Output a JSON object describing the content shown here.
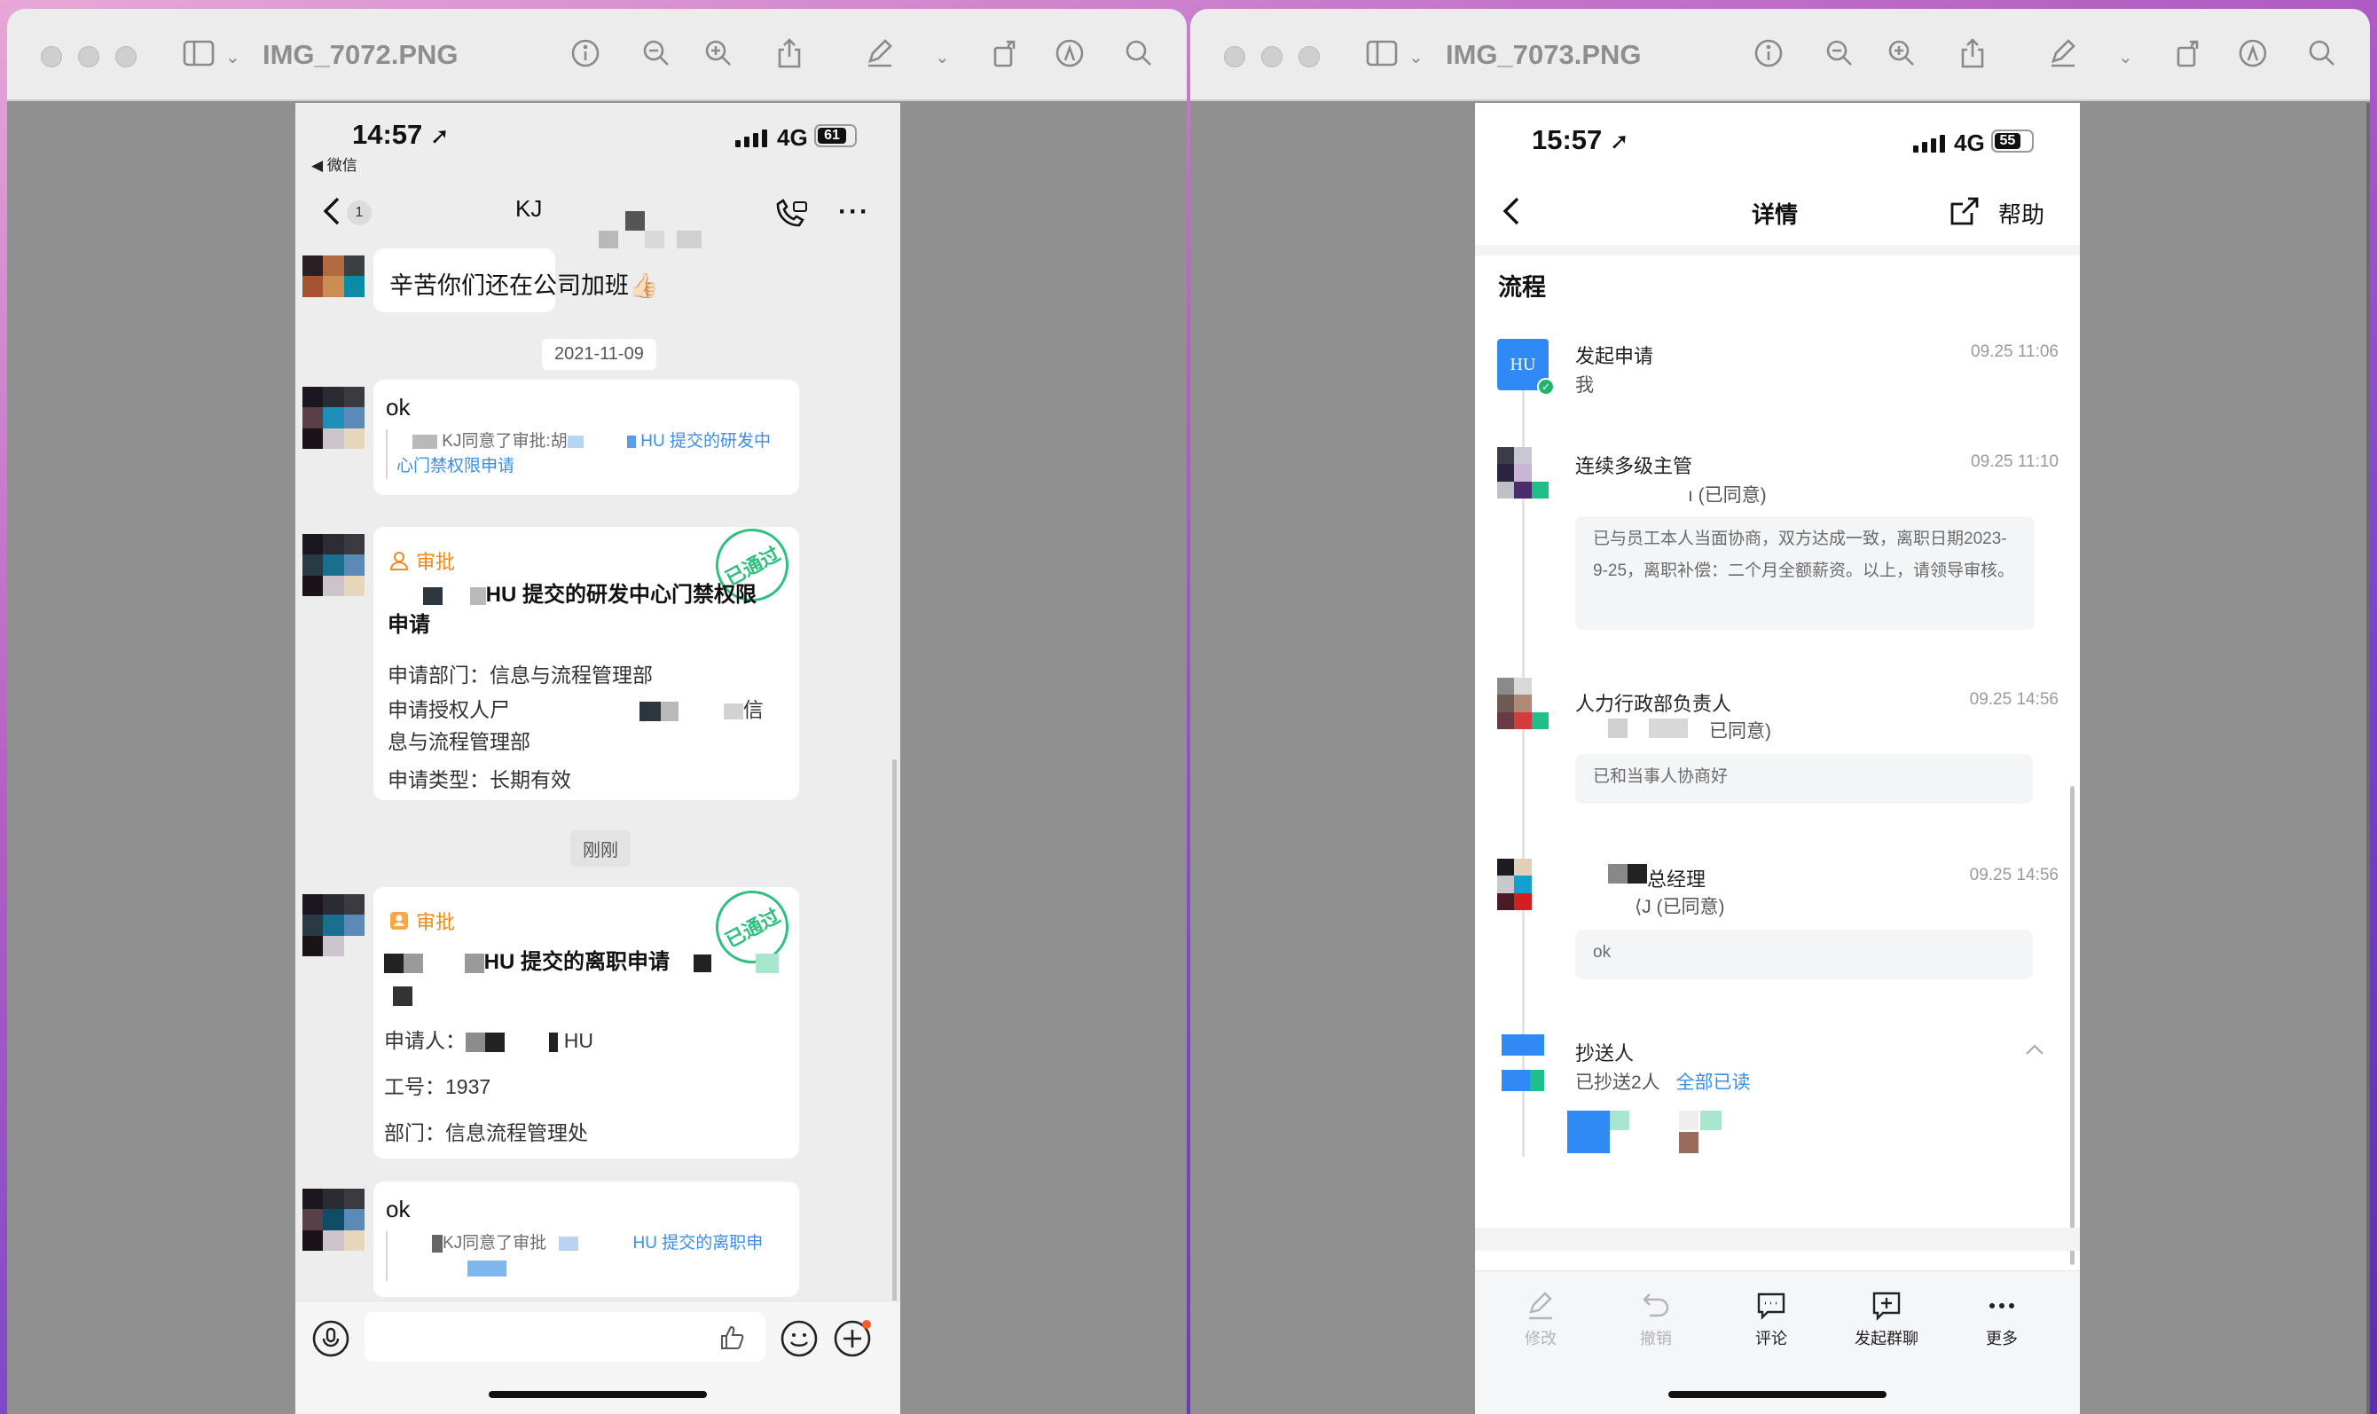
{
  "left_window": {
    "title": "IMG_7072.PNG",
    "status": {
      "time": "14:57",
      "network": "4G",
      "battery": "61",
      "back_app": "◀ 微信"
    },
    "chat": {
      "title": "KJ",
      "unread_badge": "1",
      "messages": [
        {
          "text": "辛苦你们还在公司加班👍🏻"
        },
        {
          "timestamp": "2021-11-09"
        },
        {
          "text": "ok",
          "quote_a": "KJ同意了审批:胡",
          "quote_b": "HU 提交的研发中",
          "quote_c": "心门禁权限申请"
        },
        {
          "app": "审批",
          "stamp": "已通过",
          "title_a": "HU 提交的研发中心门禁权限",
          "title_b": "申请",
          "dept": "申请部门：信息与流程管理部",
          "auth_a": "申请授权人尸",
          "auth_b": "信",
          "auth_c": "息与流程管理部",
          "type": "申请类型：长期有效"
        },
        {
          "timestamp": "刚刚"
        },
        {
          "app": "审批",
          "stamp": "已通过",
          "title": "HU 提交的离职申请",
          "applicant_label": "申请人：",
          "applicant_suffix": "HU",
          "empno": "工号：1937",
          "dept": "部门：信息流程管理处"
        },
        {
          "text": "ok",
          "quote_a": "KJ同意了审批",
          "quote_b": "HU 提交的离职申"
        }
      ]
    }
  },
  "right_window": {
    "title": "IMG_7073.PNG",
    "status": {
      "time": "15:57",
      "network": "4G",
      "battery": "55"
    },
    "header": {
      "title": "详情",
      "help": "帮助"
    },
    "section": "流程",
    "steps": [
      {
        "name": "发起申请",
        "sub": "我",
        "time": "09.25 11:06",
        "avatar": "HU"
      },
      {
        "name": "连续多级主管",
        "sub": "ı (已同意)",
        "time": "09.25 11:10",
        "comment": "已与员工本人当面协商，双方达成一致，离职日期2023-9-25，离职补偿：二个月全额薪资。以上，请领导审核。"
      },
      {
        "name": "人力行政部负责人",
        "sub": "已同意)",
        "time": "09.25 14:56",
        "comment": "已和当事人协商好"
      },
      {
        "name": "总经理",
        "sub": "⟨J (已同意)",
        "time": "09.25 14:56",
        "comment": "ok"
      },
      {
        "name": "抄送人",
        "sub": "已抄送2人",
        "sub_link": "全部已读"
      }
    ],
    "bottom": [
      {
        "label": "修改",
        "enabled": false
      },
      {
        "label": "撤销",
        "enabled": false
      },
      {
        "label": "评论",
        "enabled": true
      },
      {
        "label": "发起群聊",
        "enabled": true
      },
      {
        "label": "更多",
        "enabled": true
      }
    ]
  },
  "colors": {
    "accent_blue": "#3b8de6",
    "stamp_green": "#2fbf7e",
    "approve_orange": "#f08a1c"
  }
}
